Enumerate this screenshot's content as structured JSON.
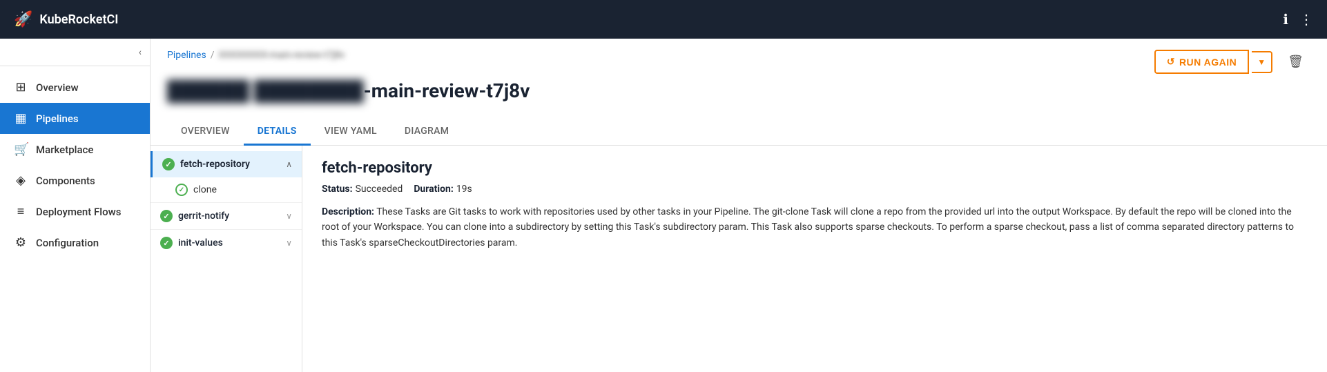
{
  "header": {
    "logo_icon": "🚀",
    "title": "KubeRocketCI",
    "info_icon": "ℹ",
    "menu_icon": "⋮"
  },
  "sidebar": {
    "collapse_icon": "‹",
    "items": [
      {
        "id": "overview",
        "label": "Overview",
        "icon": "⊞"
      },
      {
        "id": "pipelines",
        "label": "Pipelines",
        "icon": "▦",
        "active": true
      },
      {
        "id": "marketplace",
        "label": "Marketplace",
        "icon": "🛒"
      },
      {
        "id": "components",
        "label": "Components",
        "icon": "◈"
      },
      {
        "id": "deployment-flows",
        "label": "Deployment Flows",
        "icon": "≡"
      },
      {
        "id": "configuration",
        "label": "Configuration",
        "icon": "⚙"
      }
    ]
  },
  "breadcrumb": {
    "link_label": "Pipelines",
    "separator": "/",
    "current": "XXXXXXXX-main-review-t7j8v"
  },
  "page_title": {
    "blurred_part": "XXXXXXXX XXXXXXX",
    "visible_part": "-main-review-t7j8v"
  },
  "actions": {
    "run_again_label": "RUN AGAIN",
    "run_again_icon": "↺",
    "dropdown_icon": "▼",
    "delete_icon": "🗑"
  },
  "tabs": [
    {
      "id": "overview",
      "label": "OVERVIEW",
      "active": false
    },
    {
      "id": "details",
      "label": "DETAILS",
      "active": true
    },
    {
      "id": "view-yaml",
      "label": "VIEW YAML",
      "active": false
    },
    {
      "id": "diagram",
      "label": "DIAGRAM",
      "active": false
    }
  ],
  "task_list": {
    "items": [
      {
        "id": "fetch-repository",
        "name": "fetch-repository",
        "status": "success-filled",
        "expanded": true,
        "sub_items": [
          {
            "id": "clone",
            "name": "clone",
            "status": "success-outline"
          }
        ]
      },
      {
        "id": "gerrit-notify",
        "name": "gerrit-notify",
        "status": "success-filled",
        "expanded": false
      },
      {
        "id": "init-values",
        "name": "init-values",
        "status": "success-filled",
        "expanded": false
      }
    ]
  },
  "task_detail": {
    "title": "fetch-repository",
    "status_label": "Status:",
    "status_value": "Succeeded",
    "duration_label": "Duration:",
    "duration_value": "19s",
    "description_label": "Description:",
    "description_text": "These Tasks are Git tasks to work with repositories used by other tasks in your Pipeline. The git-clone Task will clone a repo from the provided url into the output Workspace. By default the repo will be cloned into the root of your Workspace. You can clone into a subdirectory by setting this Task's subdirectory param. This Task also supports sparse checkouts. To perform a sparse checkout, pass a list of comma separated directory patterns to this Task's sparseCheckoutDirectories param."
  }
}
